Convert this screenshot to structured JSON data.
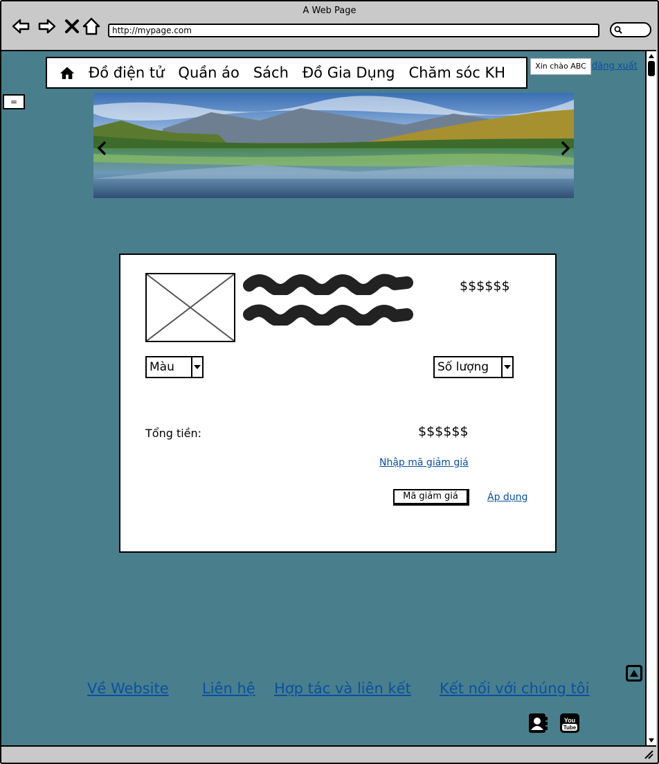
{
  "browser": {
    "title": "A Web Page",
    "url": "http://mypage.com"
  },
  "nav": {
    "items": [
      {
        "label": "Đồ điện tử"
      },
      {
        "label": "Quần áo"
      },
      {
        "label": "Sách"
      },
      {
        "label": "Đồ Gia Dụng"
      },
      {
        "label": "Chăm sóc KH"
      }
    ]
  },
  "user": {
    "greeting": "Xin chào ABC",
    "logout": "đăng xuất"
  },
  "sidebar": {
    "toggle": "="
  },
  "product": {
    "price": "$$$$$$",
    "color_select": "Màu",
    "quantity_select": "Số lượng",
    "total_label": "Tổng tiền:",
    "total_value": "$$$$$$",
    "coupon_link": "Nhập mã giảm giá",
    "coupon_placeholder": "Mã giảm giá",
    "apply_link": "Áp dụng"
  },
  "footer": {
    "links": [
      {
        "label": "Về Website"
      },
      {
        "label": "Liên hệ"
      },
      {
        "label": "Hợp tác và liên kết"
      },
      {
        "label": "Kết nối với chúng tôi"
      }
    ]
  },
  "icons": {
    "home": "home-icon",
    "back": "arrow-left-icon",
    "forward": "arrow-right-icon",
    "stop": "close-icon",
    "reload_home": "home-outline-icon",
    "search": "search-icon",
    "contacts": "address-book-icon",
    "youtube": "youtube-icon",
    "back_to_top": "arrow-up-icon"
  },
  "colors": {
    "page_background": "#497f8c",
    "link": "#0a4fa0"
  }
}
